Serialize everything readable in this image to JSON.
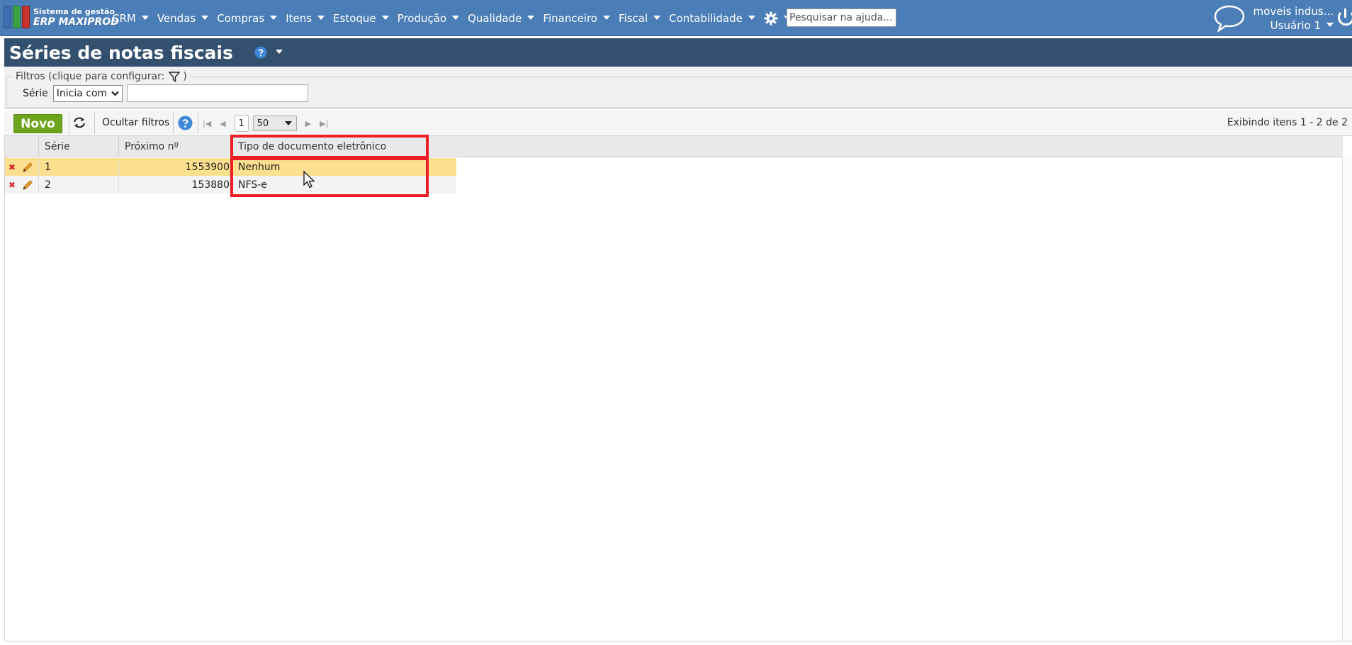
{
  "app": {
    "logo_line1": "Sistema de gestão",
    "logo_line2": "ERP MAXIPROD"
  },
  "nav": {
    "items": [
      "CRM",
      "Vendas",
      "Compras",
      "Itens",
      "Estoque",
      "Produção",
      "Qualidade",
      "Financeiro",
      "Fiscal",
      "Contabilidade"
    ],
    "icons": [
      "gear-icon",
      "help-circle-icon"
    ],
    "search_placeholder": "Pesquisar na ajuda...",
    "company": "moveis indus...",
    "user": "Usuário 1"
  },
  "page": {
    "title": "Séries de notas fiscais"
  },
  "filters": {
    "legend": "Filtros (clique para configurar:",
    "legend_close": ")",
    "serie_label": "Série",
    "serie_mode": "Inicia com",
    "serie_value": ""
  },
  "toolbar": {
    "new_label": "Novo",
    "hide_filters_label": "Ocultar filtros",
    "page": "1",
    "page_size": "50",
    "showing": "Exibindo itens 1 - 2 de 2"
  },
  "grid": {
    "columns": [
      "Série",
      "Próximo nº",
      "Tipo de documento eletrônico"
    ],
    "rows": [
      {
        "serie": "1",
        "proximo": "1553900",
        "tipo": "Nenhum"
      },
      {
        "serie": "2",
        "proximo": "153880",
        "tipo": "NFS-e"
      }
    ]
  },
  "colors": {
    "nav_bg": "#4b7eb7",
    "title_bg": "#33506f",
    "new_button": "#6ca51c",
    "selected_row": "#fce08f",
    "highlight": "#ee1c24"
  }
}
